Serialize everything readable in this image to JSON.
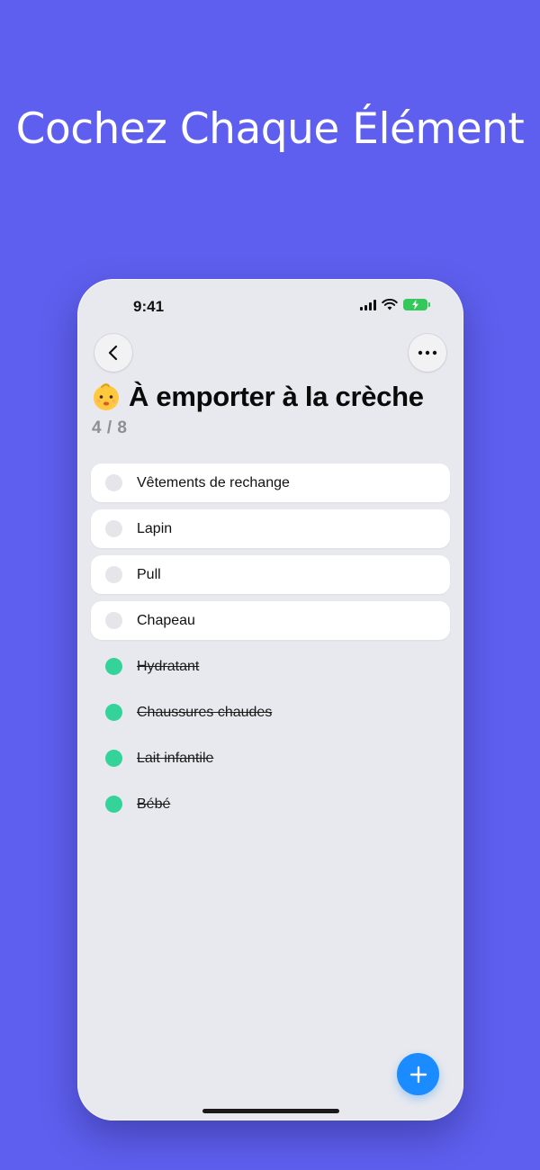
{
  "headline": "Cochez Chaque Élément",
  "status_bar": {
    "time": "9:41"
  },
  "icons": {
    "back": "chevron-left-icon",
    "more": "ellipsis-icon",
    "add": "plus-icon",
    "title_emoji": "baby-face-icon"
  },
  "list": {
    "title": "À emporter à la crèche",
    "progress": "4 / 8",
    "open_items": [
      {
        "label": "Vêtements de rechange"
      },
      {
        "label": "Lapin"
      },
      {
        "label": "Pull"
      },
      {
        "label": "Chapeau"
      }
    ],
    "done_items": [
      {
        "label": "Hydratant"
      },
      {
        "label": "Chaussures chaudes"
      },
      {
        "label": "Lait infantile"
      },
      {
        "label": "Bébé"
      }
    ]
  },
  "colors": {
    "background": "#5E5FEE",
    "check_done": "#34D399",
    "fab": "#1A8CFF",
    "battery": "#34C759"
  }
}
